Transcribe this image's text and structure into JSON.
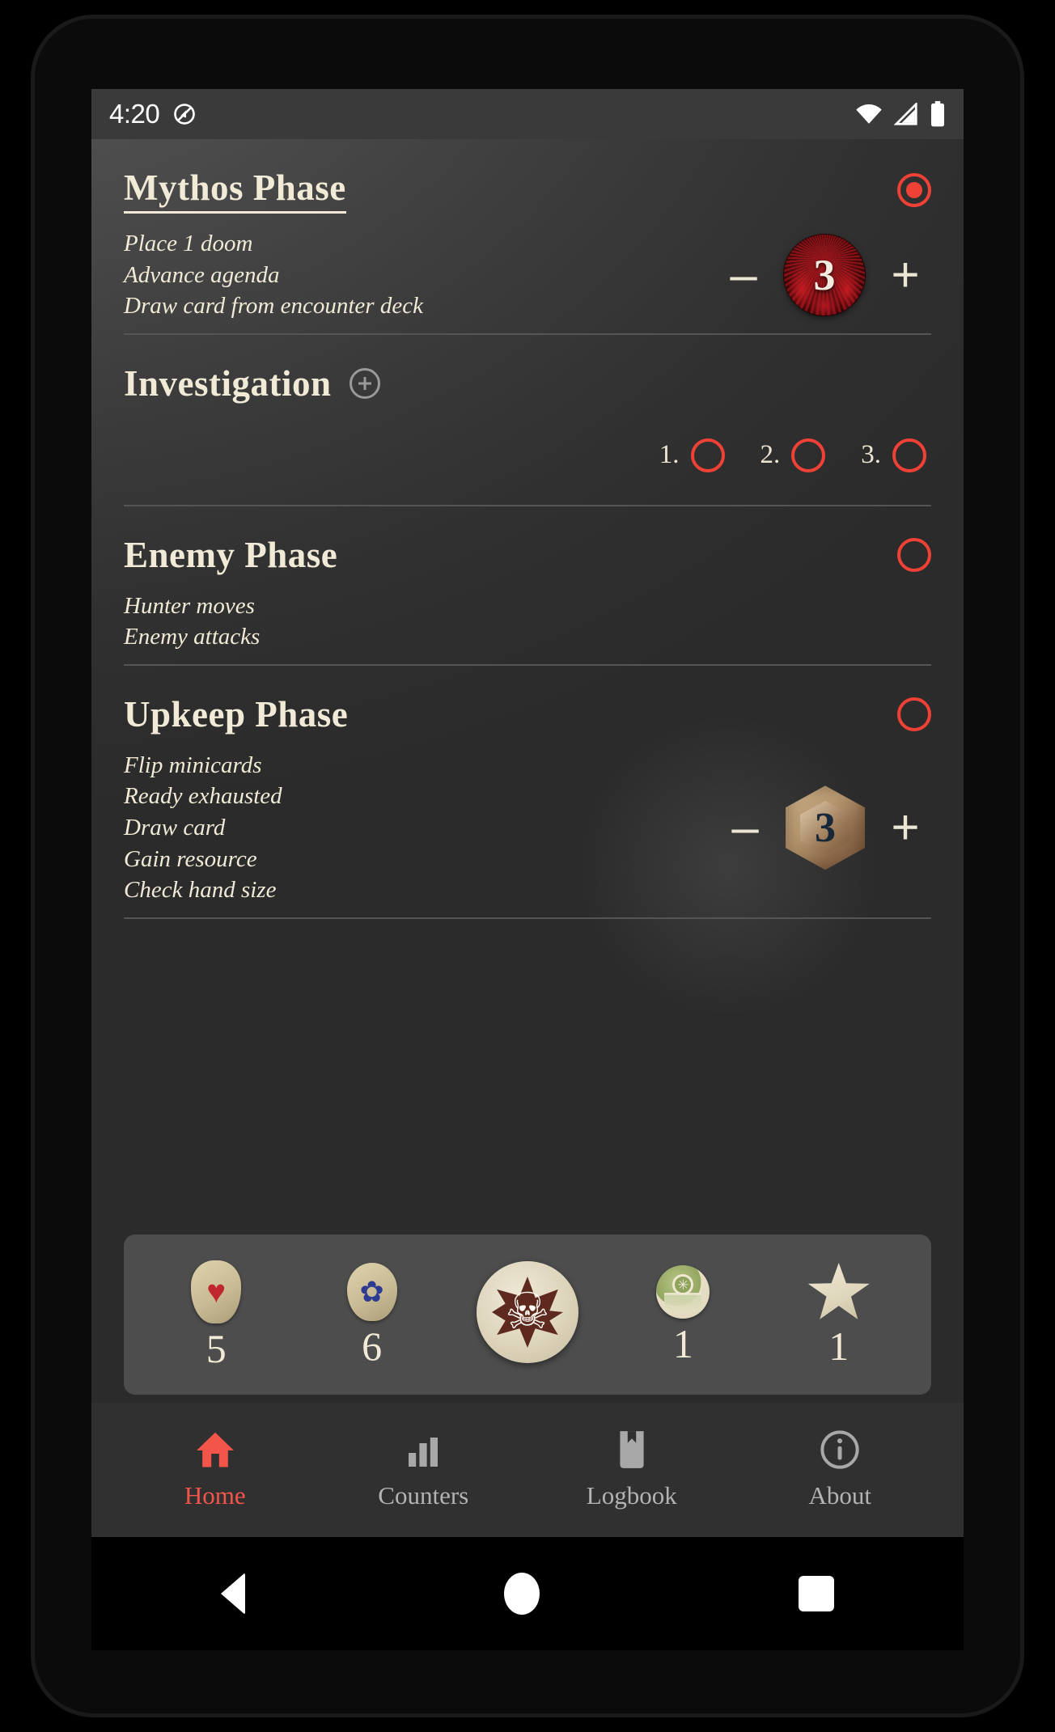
{
  "status_bar": {
    "time": "4:20",
    "icons": [
      "location-off-icon",
      "wifi-icon",
      "cell-signal-icon",
      "battery-full-icon"
    ]
  },
  "phases": [
    {
      "title": "Mythos Phase",
      "active": true,
      "radio_state": "selected",
      "steps": [
        "Place 1 doom",
        "Advance agenda",
        "Draw card from encounter deck"
      ],
      "counter": {
        "type": "doom-token",
        "value": "3",
        "minus_label": "–",
        "plus_label": "+"
      }
    },
    {
      "title": "Investigation",
      "active": false,
      "has_add_button": true,
      "actions": [
        {
          "number": "1.",
          "state": "empty"
        },
        {
          "number": "2.",
          "state": "empty"
        },
        {
          "number": "3.",
          "state": "empty"
        }
      ]
    },
    {
      "title": "Enemy Phase",
      "active": false,
      "radio_state": "empty",
      "steps": [
        "Hunter moves",
        "Enemy attacks"
      ]
    },
    {
      "title": "Upkeep Phase",
      "active": false,
      "radio_state": "empty",
      "steps": [
        "Flip minicards",
        "Ready exhausted",
        "Draw card",
        "Gain resource",
        "Check hand size"
      ],
      "counter": {
        "type": "resource-token",
        "value": "3",
        "minus_label": "–",
        "plus_label": "+"
      }
    }
  ],
  "counter_bar": [
    {
      "name": "health-token",
      "glyph": "♥",
      "value": "5"
    },
    {
      "name": "sanity-token",
      "glyph": "✿",
      "value": "6"
    },
    {
      "name": "chaos-token",
      "glyph": "☠",
      "value": ""
    },
    {
      "name": "clue-token",
      "glyph": "✳",
      "value": "1"
    },
    {
      "name": "resource-star-token",
      "glyph": "★",
      "value": "1"
    }
  ],
  "bottom_nav": [
    {
      "label": "Home",
      "icon": "home-icon",
      "active": true
    },
    {
      "label": "Counters",
      "icon": "bar-chart-icon",
      "active": false
    },
    {
      "label": "Logbook",
      "icon": "bookmark-icon",
      "active": false
    },
    {
      "label": "About",
      "icon": "info-icon",
      "active": false
    }
  ],
  "android_nav": [
    "back-button",
    "home-button",
    "recents-button"
  ],
  "colors": {
    "accent_red": "#ef4136",
    "cream": "#f0ead6",
    "bg_dark": "#2e2e2e",
    "counter_bar_bg": "#4d4d4d"
  }
}
